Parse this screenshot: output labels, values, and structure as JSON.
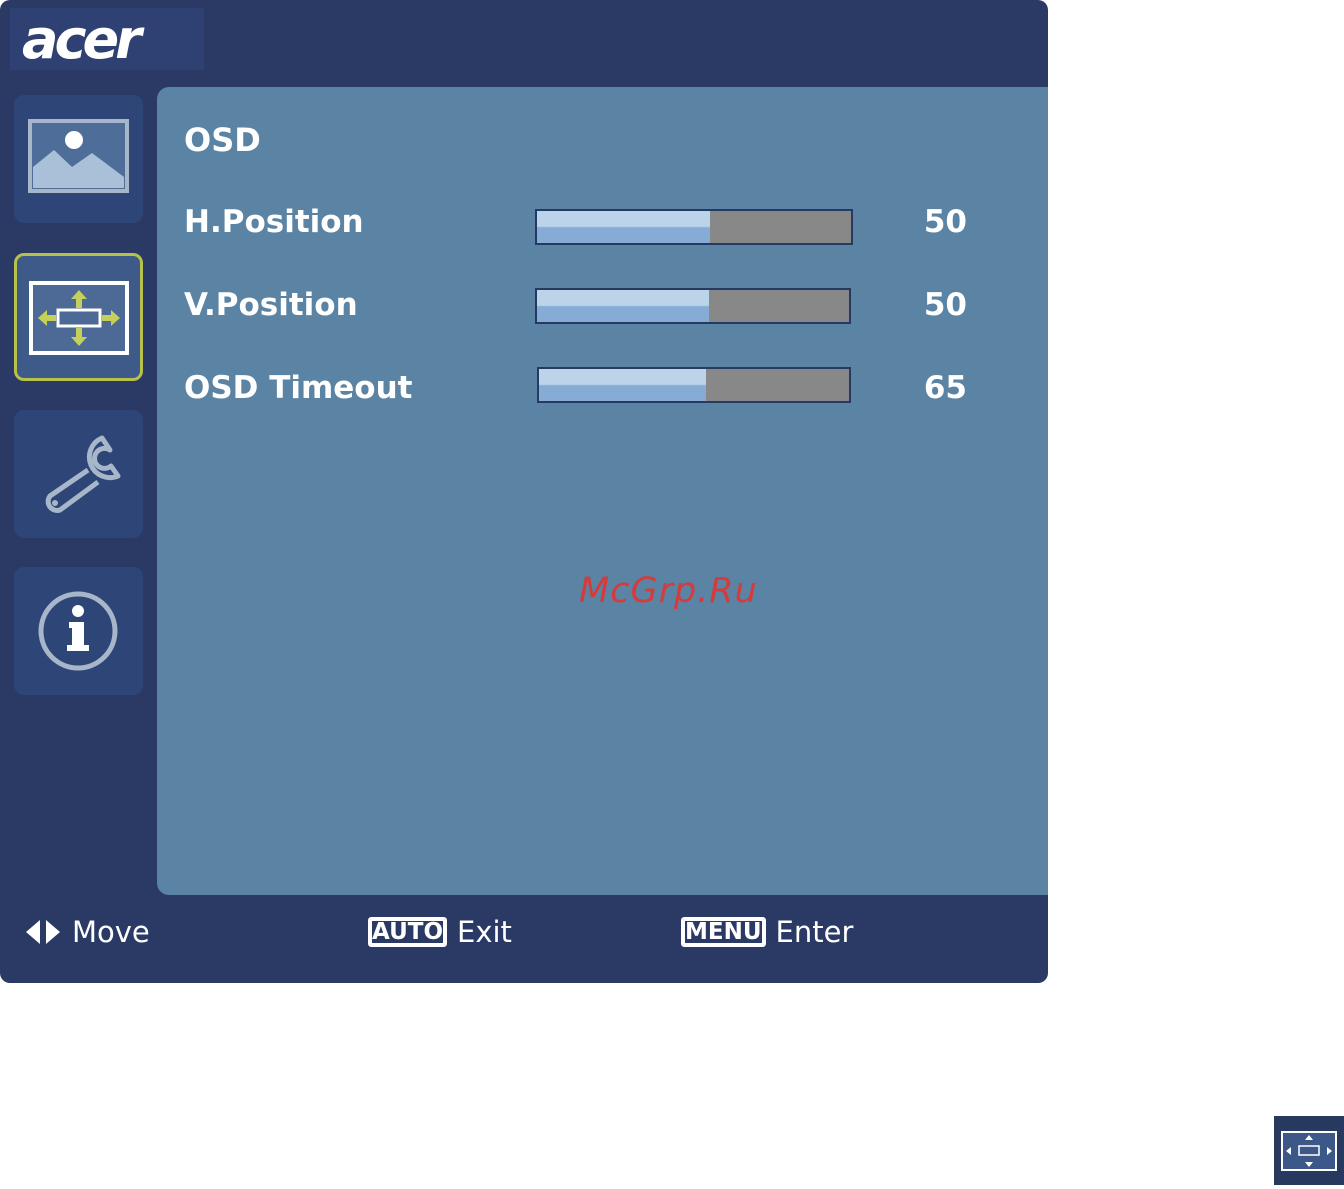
{
  "brand": {
    "logo_text": "acer"
  },
  "sidebar": {
    "items": [
      {
        "icon": "picture-icon",
        "active": false
      },
      {
        "icon": "position-icon",
        "active": true
      },
      {
        "icon": "wrench-icon",
        "active": false
      },
      {
        "icon": "info-icon",
        "active": false
      }
    ],
    "active_color": "#b6c24a"
  },
  "menu": {
    "title": "OSD",
    "rows": [
      {
        "label": "H.Position",
        "value": "50",
        "level_percent": 55
      },
      {
        "label": "V.Position",
        "value": "50",
        "level_percent": 55
      },
      {
        "label": "OSD Timeout",
        "value": "65",
        "level_percent": 54
      }
    ]
  },
  "footer": {
    "move_label": "Move",
    "auto_key": "AUTO",
    "exit_label": "Exit",
    "menu_key": "MENU",
    "enter_label": "Enter"
  },
  "watermark": "McGrp.Ru",
  "colors": {
    "frame": "#2a3a65",
    "panel": "#5a83a4",
    "slider_fill": "#86acd6",
    "slider_empty": "#888888",
    "watermark": "#d73a3a"
  }
}
